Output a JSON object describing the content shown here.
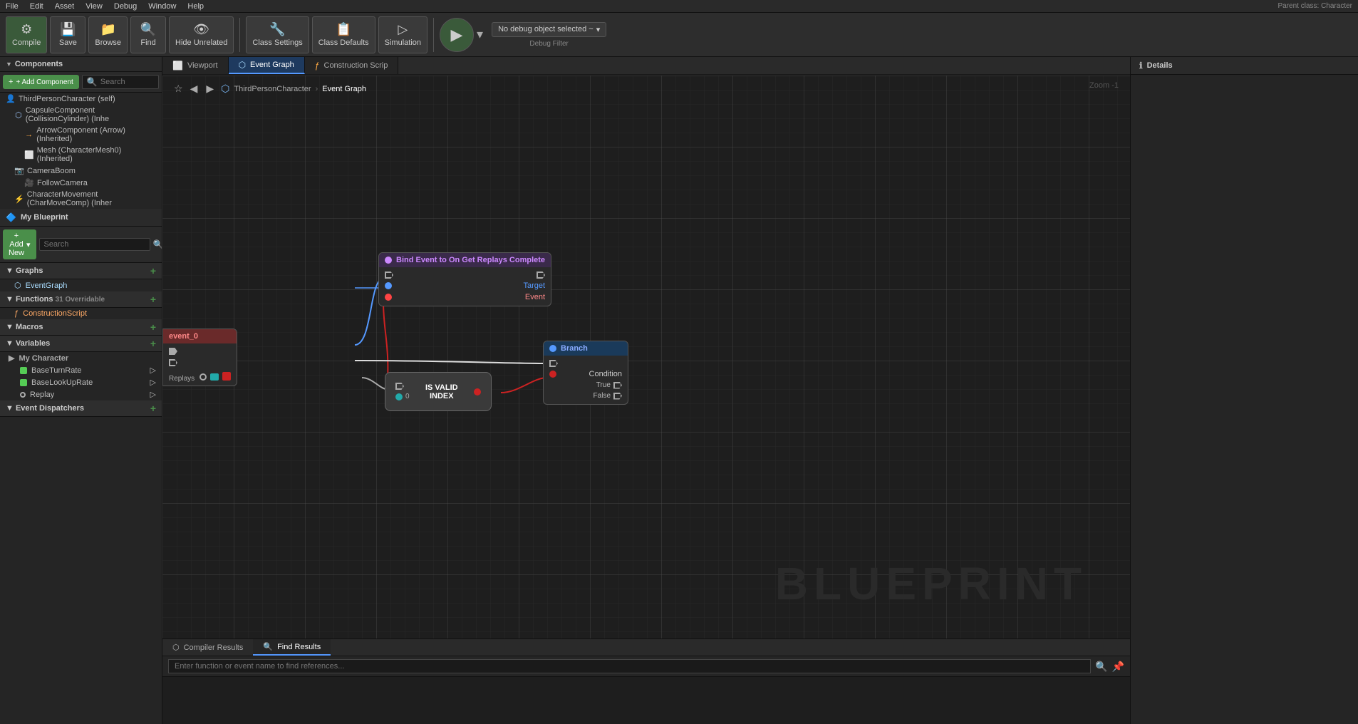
{
  "menubar": {
    "items": [
      "File",
      "Edit",
      "Asset",
      "View",
      "Debug",
      "Window",
      "Help"
    ],
    "parent_class": "Parent class: Character"
  },
  "toolbar": {
    "compile_label": "Compile",
    "save_label": "Save",
    "browse_label": "Browse",
    "find_label": "Find",
    "hide_unrelated_label": "Hide Unrelated",
    "class_settings_label": "Class Settings",
    "class_defaults_label": "Class Defaults",
    "simulation_label": "Simulation",
    "play_label": "Play",
    "debug_object": "No debug object selected ~",
    "debug_filter_label": "Debug Filter"
  },
  "components": {
    "section_label": "Components",
    "add_btn_label": "+ Add Component",
    "search_placeholder": "Search",
    "items": [
      {
        "label": "ThirdPersonCharacter (self)",
        "level": 0,
        "icon": "person"
      },
      {
        "label": "CapsuleComponent (CollisionCylinder) (Inhe",
        "level": 1,
        "icon": "capsule"
      },
      {
        "label": "ArrowComponent (Arrow) (Inherited)",
        "level": 2,
        "icon": "arrow"
      },
      {
        "label": "Mesh (CharacterMesh0) (Inherited)",
        "level": 2,
        "icon": "mesh"
      },
      {
        "label": "CameraBoom",
        "level": 1,
        "icon": "camera-boom"
      },
      {
        "label": "FollowCamera",
        "level": 2,
        "icon": "camera"
      },
      {
        "label": "CharacterMovement (CharMoveComp) (Inher",
        "level": 1,
        "icon": "movement"
      }
    ]
  },
  "my_blueprint": {
    "section_label": "My Blueprint",
    "add_new_label": "+ Add New",
    "search_placeholder": "Search",
    "sections": {
      "graphs": {
        "label": "Graphs",
        "items": [
          "EventGraph"
        ]
      },
      "functions": {
        "label": "Functions",
        "overridable_count": "31 Overridable",
        "items": [
          "ConstructionScript"
        ]
      },
      "macros": {
        "label": "Macros",
        "items": []
      },
      "variables": {
        "label": "Variables",
        "items": []
      },
      "my_character": {
        "label": "My Character",
        "items": [
          {
            "name": "BaseTurnRate",
            "color": "green"
          },
          {
            "name": "BaseLookUpRate",
            "color": "green"
          },
          {
            "name": "Replay",
            "color": "circle"
          }
        ]
      },
      "event_dispatchers": {
        "label": "Event Dispatchers",
        "items": []
      }
    }
  },
  "tabs": {
    "viewport_label": "Viewport",
    "event_graph_label": "Event Graph",
    "construction_script_label": "Construction Scrip"
  },
  "breadcrumb": {
    "class_name": "ThirdPersonCharacter",
    "graph_name": "Event Graph",
    "zoom": "Zoom -1"
  },
  "canvas": {
    "watermark": "BLUEPRINT",
    "nodes": {
      "bind_event": {
        "title": "Bind Event to On Get Replays Complete",
        "target_pin": "Target",
        "event_pin": "Event"
      },
      "branch": {
        "title": "Branch",
        "condition_pin": "Condition",
        "true_pin": "True",
        "false_pin": "False"
      },
      "is_valid": {
        "line1": "IS VALID",
        "line2": "INDEX"
      },
      "event_node": {
        "label": "event_0"
      }
    },
    "replays_label": "Replays"
  },
  "bottom": {
    "compiler_results_label": "Compiler Results",
    "find_results_label": "Find Results",
    "find_placeholder": "Enter function or event name to find references..."
  },
  "details": {
    "title": "Details"
  }
}
